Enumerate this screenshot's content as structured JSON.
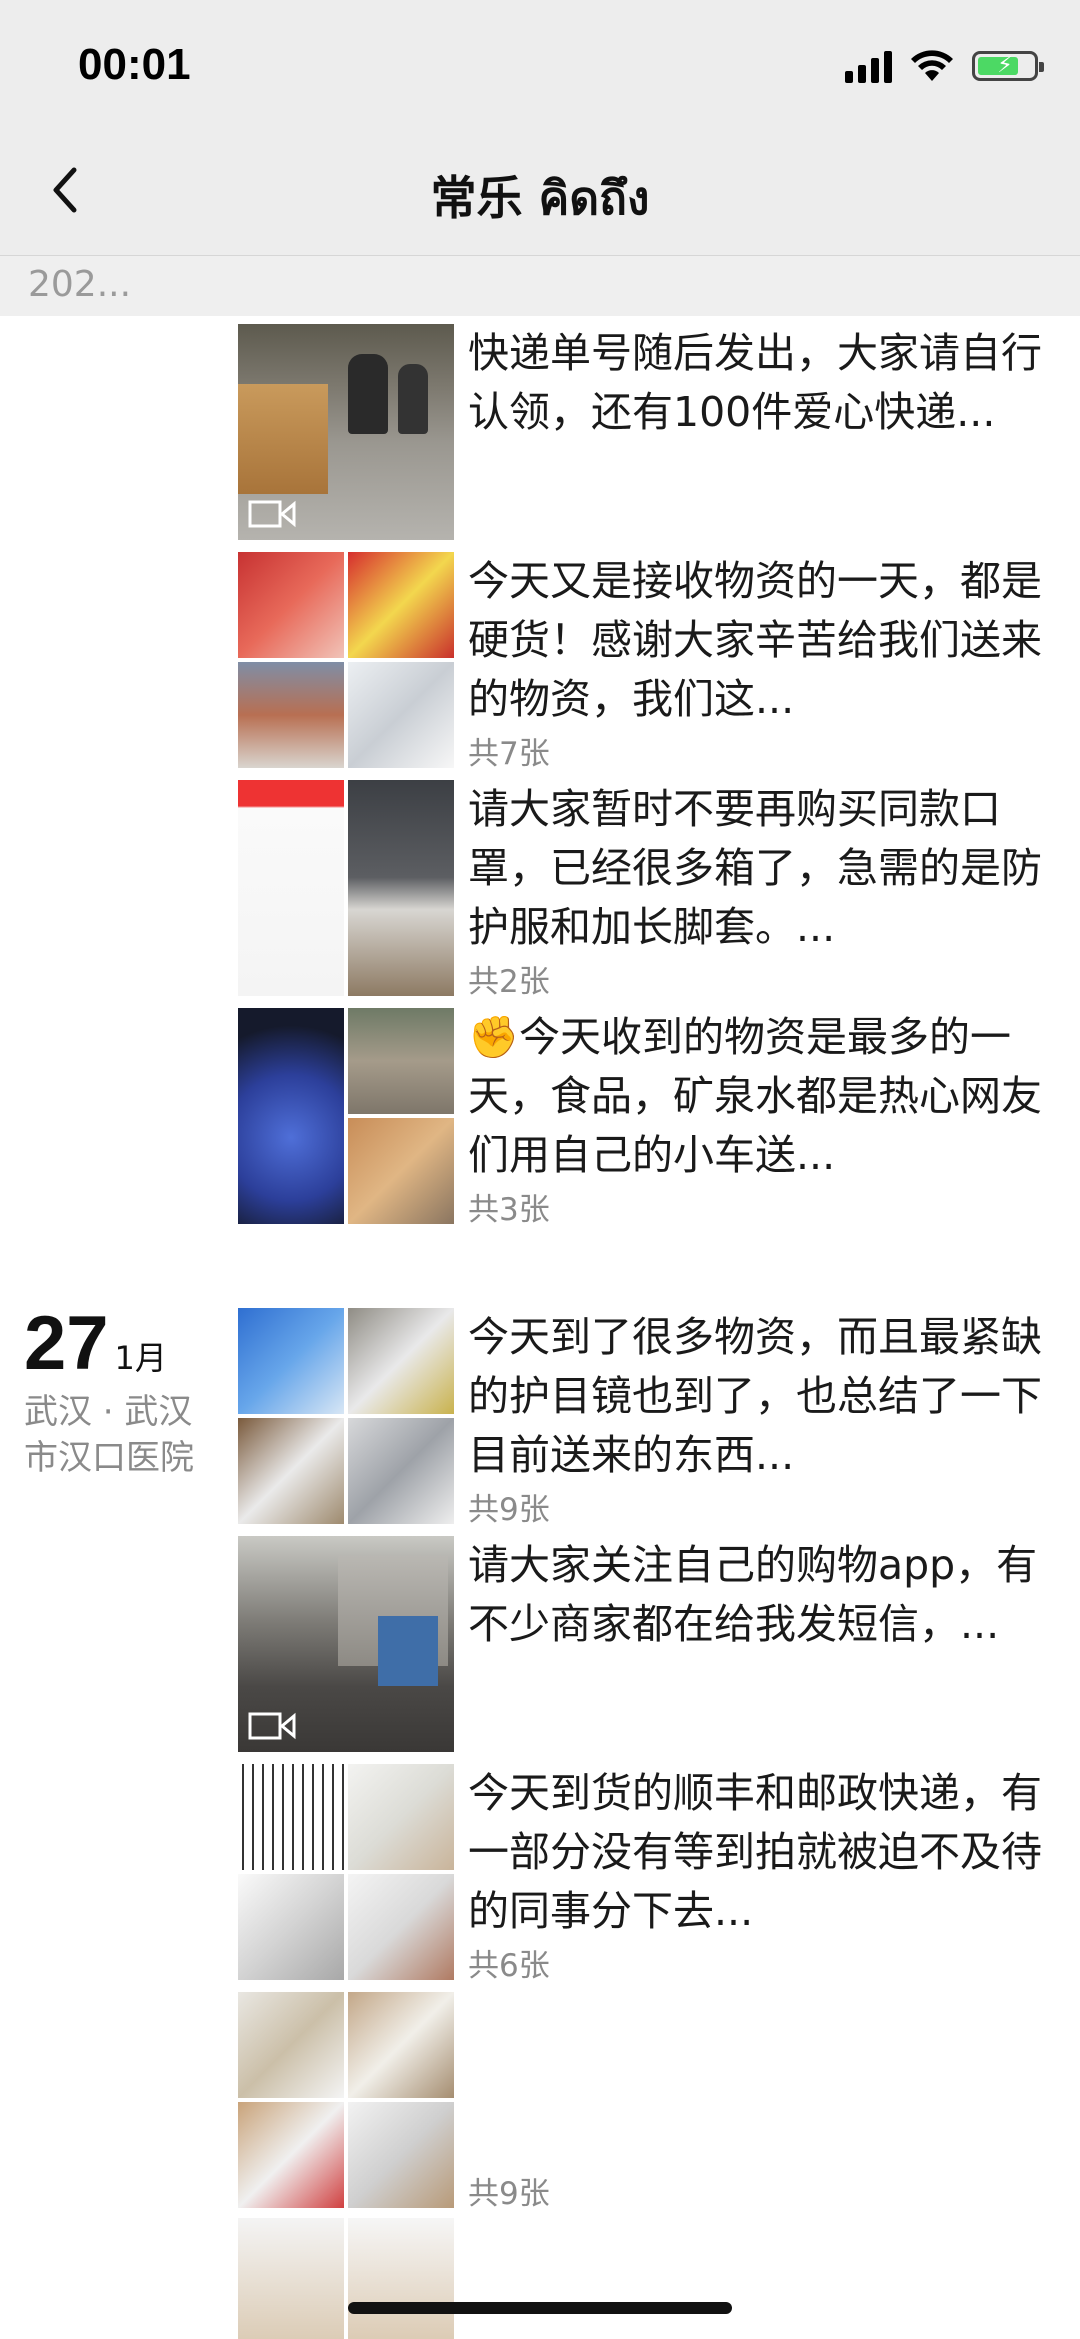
{
  "status_bar": {
    "time": "00:01"
  },
  "nav": {
    "title": "常乐 คิดถึง",
    "back_icon": "chevron-left-icon"
  },
  "year_header": "202...",
  "date_group": {
    "day": "27",
    "month": "1月",
    "location": "武汉 · 武汉市汉口医院"
  },
  "posts": [
    {
      "text": "快递单号随后发出，大家请自行认领，还有100件爱心快递...",
      "count": "",
      "media": "video"
    },
    {
      "text": "今天又是接收物资的一天，都是硬货！感谢大家辛苦给我们送来的物资，我们这...",
      "count": "共7张",
      "media": "grid4"
    },
    {
      "text": "请大家暂时不要再购买同款口罩，已经很多箱了，急需的是防护服和加长脚套。...",
      "count": "共2张",
      "media": "grid2"
    },
    {
      "text": "✊今天收到的物资是最多的一天，食品，矿泉水都是热心网友们用自己的小车送...",
      "count": "共3张",
      "media": "grid3"
    },
    {
      "text": "今天到了很多物资，而且最紧缺的护目镜也到了，也总结了一下目前送来的东西...",
      "count": "共9张",
      "media": "grid4"
    },
    {
      "text": "请大家关注自己的购物app，有不少商家都在给我发短信，...",
      "count": "",
      "media": "video"
    },
    {
      "text": "今天到货的顺丰和邮政快递，有一部分没有等到拍就被迫不及待的同事分下去...",
      "count": "共6张",
      "media": "grid4"
    },
    {
      "text": "",
      "count": "共9张",
      "media": "grid4"
    },
    {
      "text": "",
      "count": "",
      "media": "grid2"
    }
  ]
}
